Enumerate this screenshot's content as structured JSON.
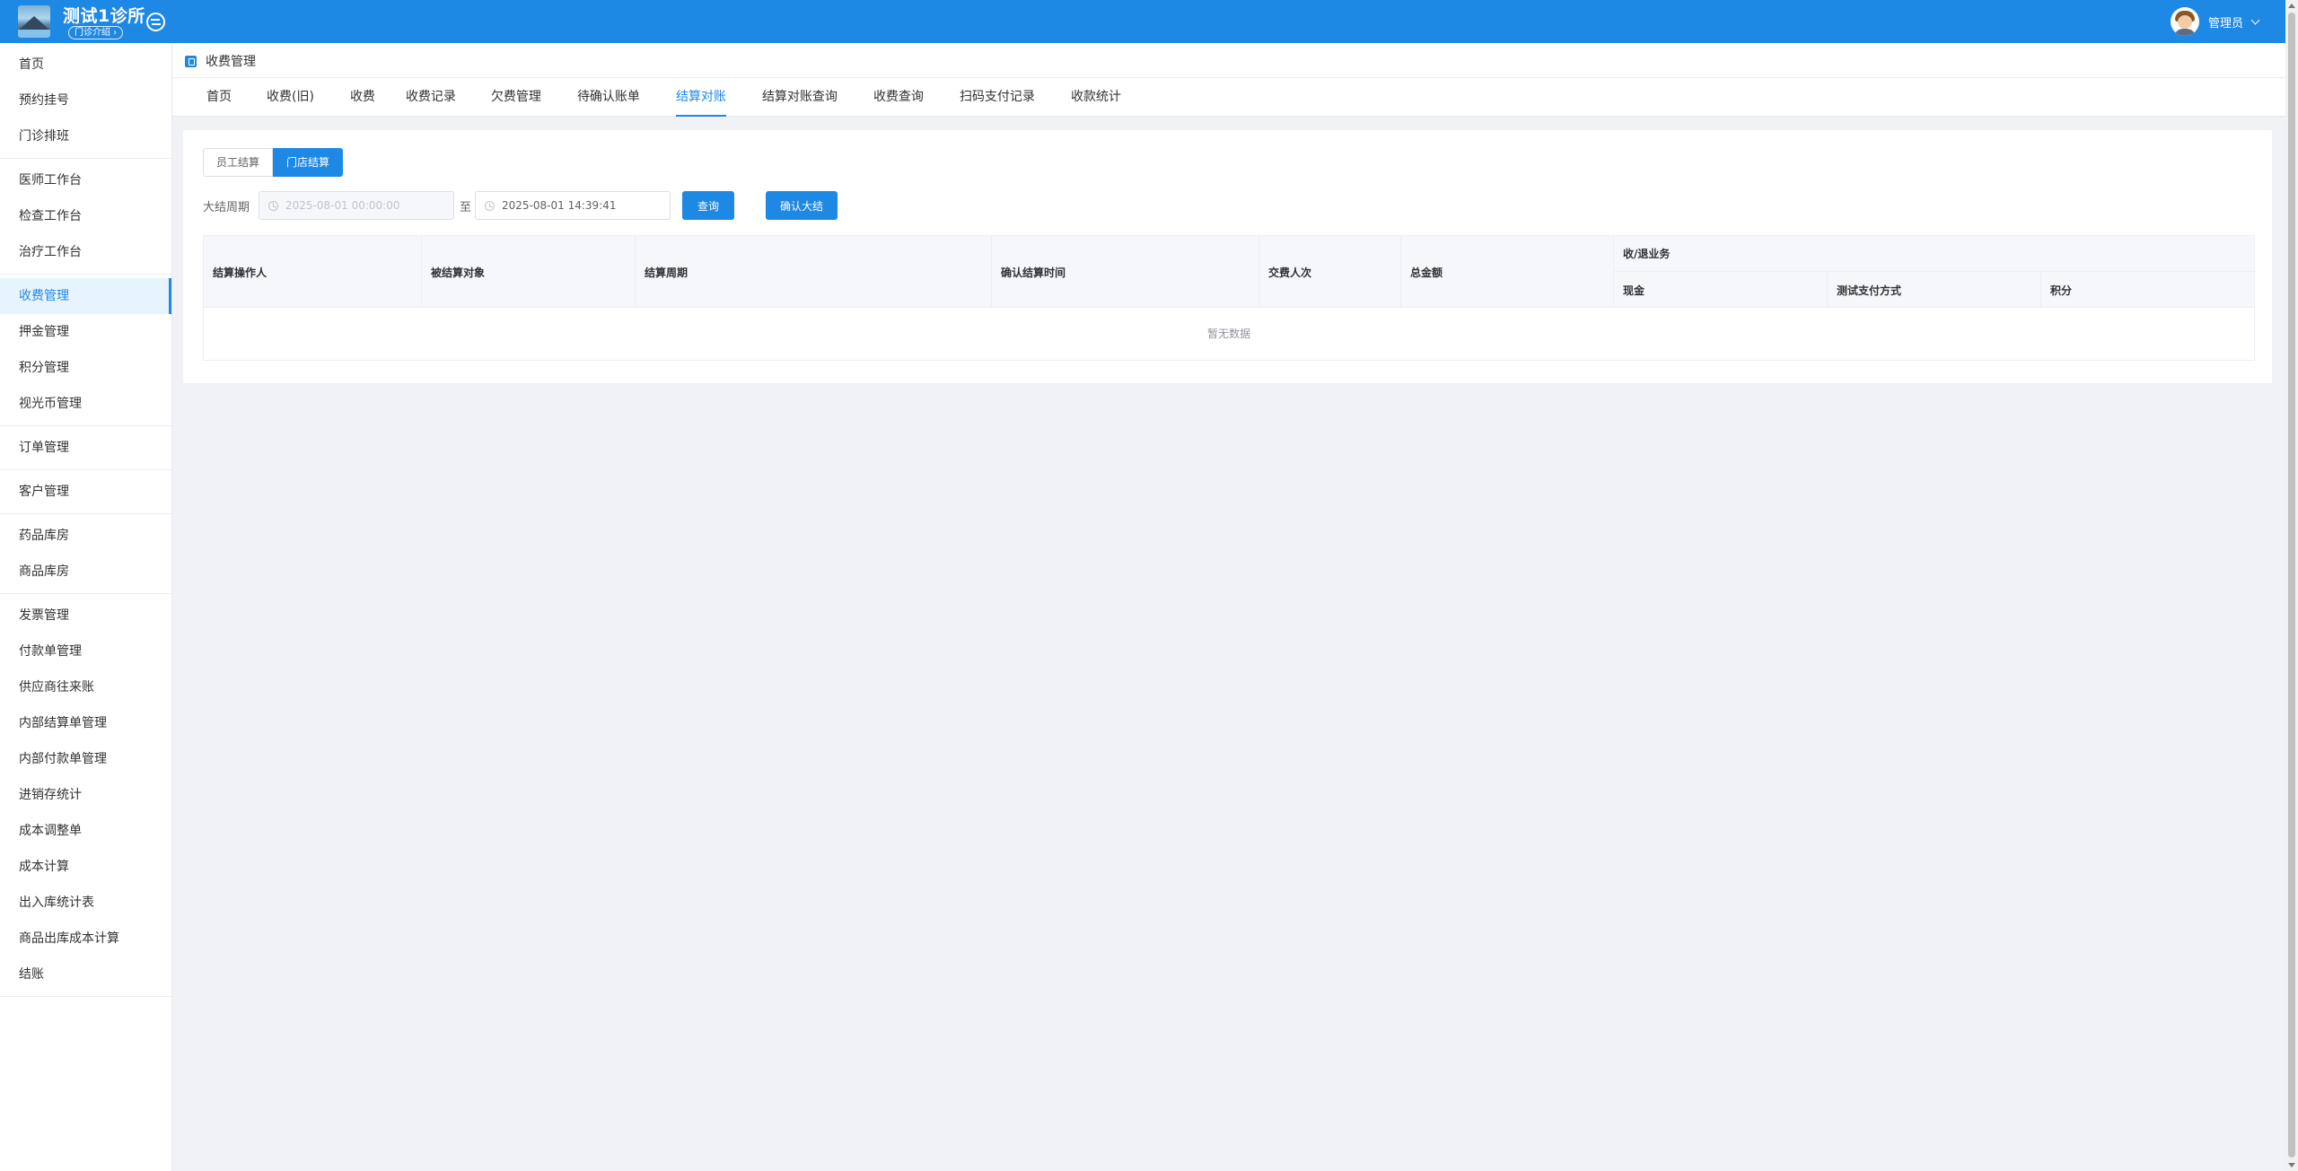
{
  "header": {
    "clinic_name": "测试1诊所",
    "clinic_badge": "门诊介绍 ›",
    "user_name": "管理员",
    "colors": {
      "primary": "#1e88e5"
    }
  },
  "sidebar": {
    "groups": [
      [
        "首页",
        "预约挂号",
        "门诊排班"
      ],
      [
        "医师工作台",
        "检查工作台",
        "治疗工作台"
      ],
      [
        "收费管理",
        "押金管理",
        "积分管理",
        "视光币管理"
      ],
      [
        "订单管理"
      ],
      [
        "客户管理"
      ],
      [
        "药品库房",
        "商品库房"
      ],
      [
        "发票管理",
        "付款单管理",
        "供应商往来账",
        "内部结算单管理",
        "内部付款单管理",
        "进销存统计",
        "成本调整单",
        "成本计算",
        "出入库统计表",
        "商品出库成本计算",
        "结账"
      ]
    ],
    "active": "收费管理"
  },
  "page": {
    "title": "收费管理",
    "tabs": [
      "首页",
      "收费(旧)",
      "收费",
      "收费记录",
      "欠费管理",
      "待确认账单",
      "结算对账",
      "结算对账查询",
      "收费查询",
      "扫码支付记录",
      "收款统计"
    ],
    "active_tab": "结算对账"
  },
  "content": {
    "segments": [
      "员工结算",
      "门店结算"
    ],
    "active_segment": "门店结算",
    "filter": {
      "label": "大结周期",
      "start_value": "2025-08-01 00:00:00",
      "separator": "至",
      "end_value": "2025-08-01 14:39:41",
      "query_label": "查询",
      "confirm_label": "确认大结"
    },
    "table": {
      "columns": [
        "结算操作人",
        "被结算对象",
        "结算周期",
        "确认结算时间",
        "交费人次",
        "总金额"
      ],
      "group_header": "收/退业务",
      "group_columns": [
        "现金",
        "测试支付方式",
        "积分"
      ],
      "empty_text": "暂无数据"
    }
  }
}
